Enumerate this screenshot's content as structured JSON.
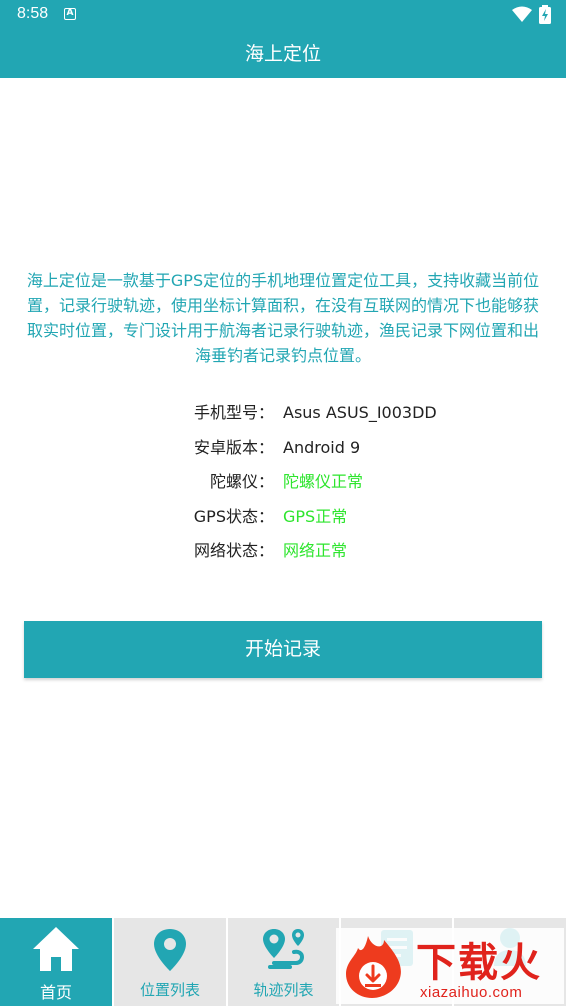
{
  "status_bar": {
    "time": "8:58",
    "notification_glyph": "A"
  },
  "app_bar": {
    "title": "海上定位"
  },
  "intro_text": "海上定位是一款基于GPS定位的手机地理位置定位工具，支持收藏当前位置，记录行驶轨迹，使用坐标计算面积，在没有互联网的情况下也能够获取实时位置，专门设计用于航海者记录行驶轨迹，渔民记录下网位置和出海垂钓者记录钓点位置。",
  "info": {
    "rows": [
      {
        "label": "手机型号：",
        "value": "Asus ASUS_I003DD"
      },
      {
        "label": "安卓版本：",
        "value": "Android 9"
      },
      {
        "label": "陀螺仪：",
        "value": "陀螺仪正常"
      },
      {
        "label": "GPS状态：",
        "value": "GPS正常"
      },
      {
        "label": "网络状态：",
        "value": "网络正常"
      }
    ]
  },
  "start_button": {
    "label": "开始记录"
  },
  "tabs": [
    {
      "label": "首页",
      "icon": "home-icon",
      "active": true
    },
    {
      "label": "位置列表",
      "icon": "location-pin-icon"
    },
    {
      "label": "轨迹列表",
      "icon": "route-icon"
    },
    {
      "label": "",
      "icon": "list-icon"
    },
    {
      "label": "",
      "icon": "profile-icon"
    }
  ],
  "watermark": {
    "logo_text": "下载火",
    "url": "xiazaihuo.com"
  },
  "colors": {
    "primary": "#22a6b3",
    "ok": "#2ee52e",
    "tab_bg": "#e6e6e6",
    "watermark": "#e0231c"
  }
}
